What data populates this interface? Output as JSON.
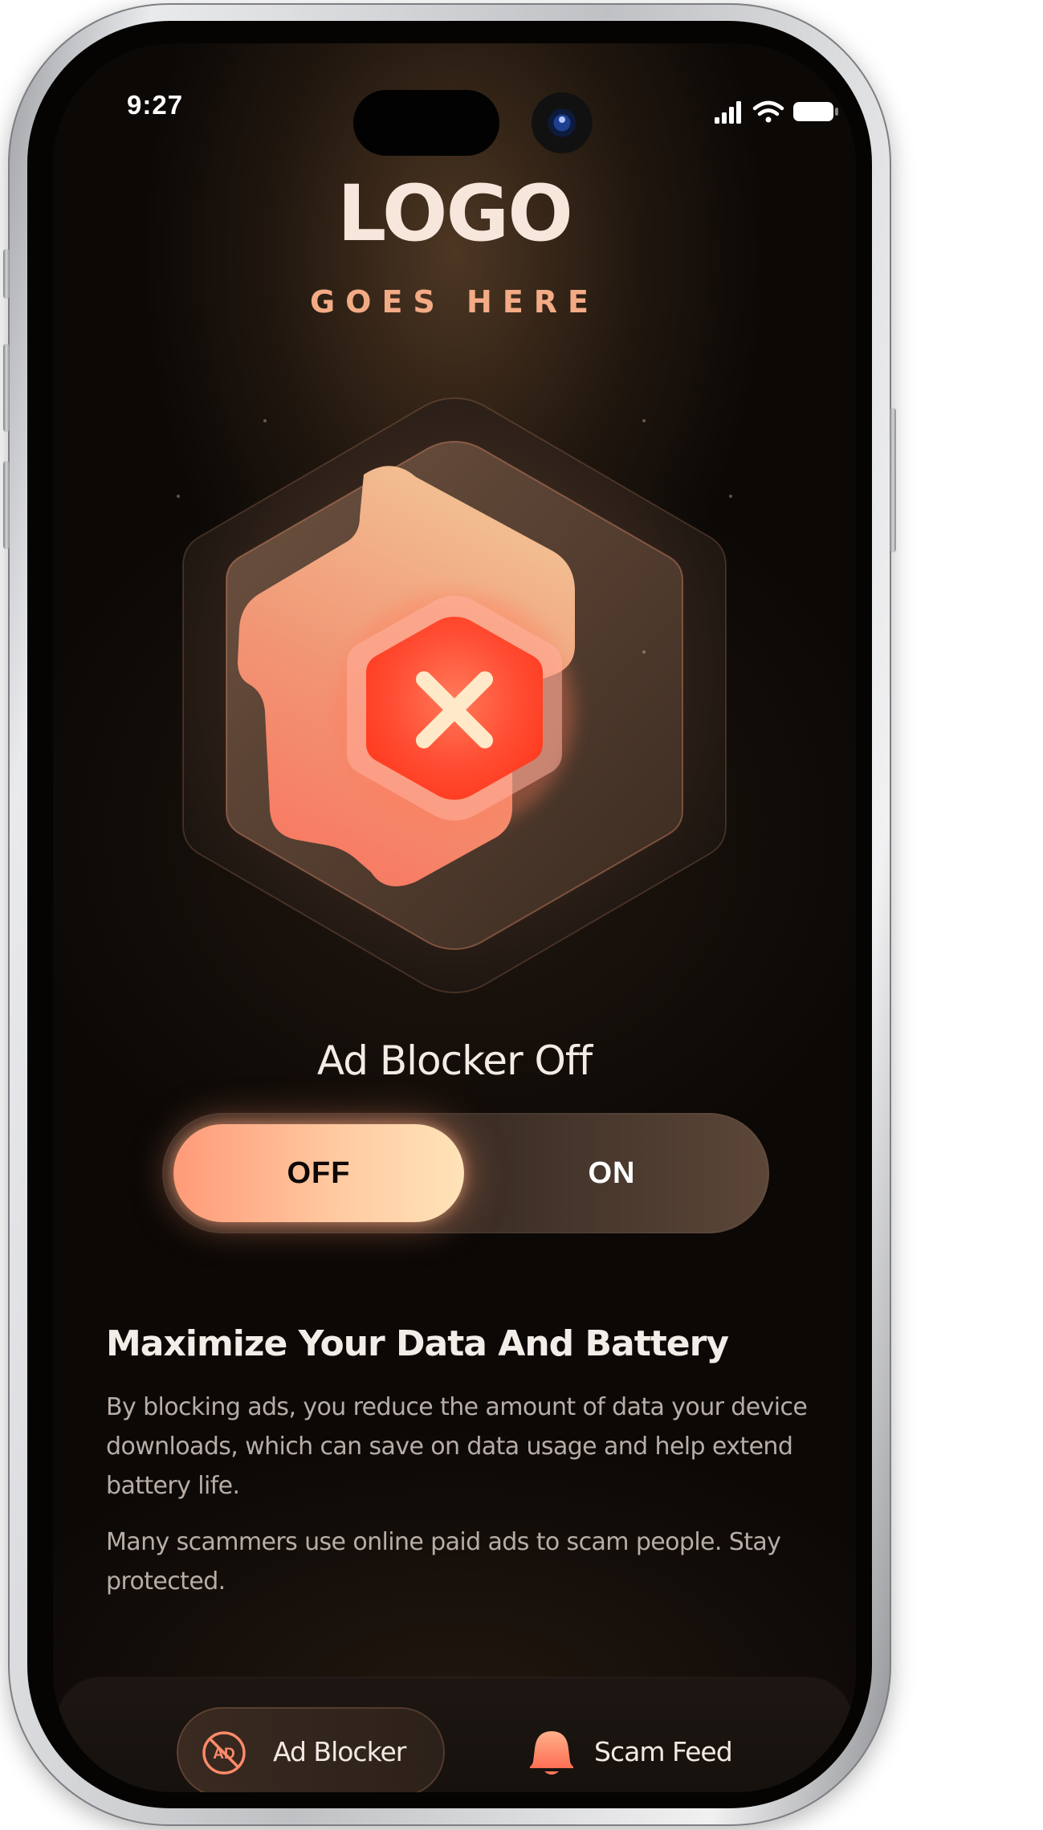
{
  "status_bar": {
    "time": "9:27"
  },
  "logo": {
    "title": "LOGO",
    "subtitle": "GOES HERE"
  },
  "status_graphic": {
    "icon": "close-x-icon",
    "state": "off"
  },
  "ad_blocker": {
    "status_title": "Ad Blocker Off",
    "toggle": {
      "off_label": "OFF",
      "on_label": "ON",
      "selected": "OFF"
    }
  },
  "info": {
    "heading": "Maximize Your Data And Battery",
    "paragraph1": "By blocking ads, you reduce the amount of data your device downloads, which can save on data usage and help extend battery life.",
    "paragraph2": "Many scammers use online paid ads to scam people. Stay protected."
  },
  "bottom_nav": {
    "items": [
      {
        "label": "Ad Blocker",
        "icon": "ad-block-icon",
        "active": true
      },
      {
        "label": "Scam Feed",
        "icon": "bell-icon",
        "active": false
      }
    ]
  },
  "colors": {
    "accent": "#ff9a78",
    "accent_light": "#ffe3b8",
    "background": "#0b0806",
    "danger": "#ff4a2e"
  }
}
